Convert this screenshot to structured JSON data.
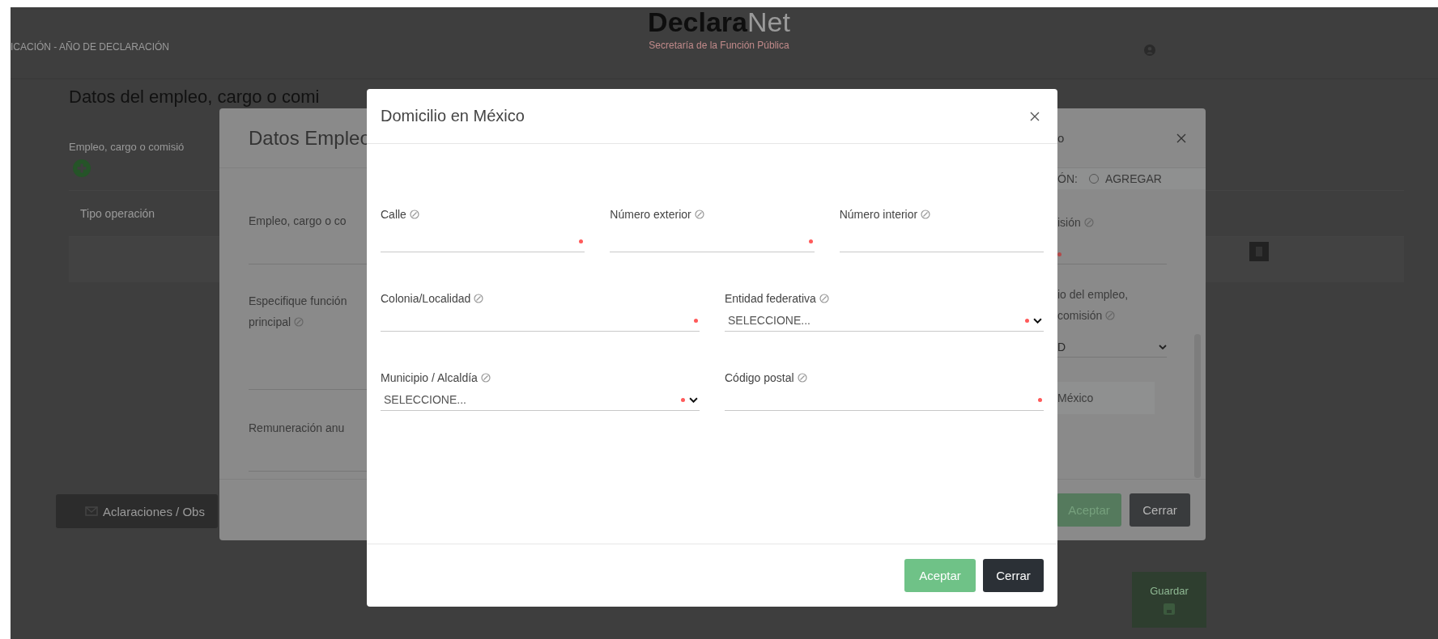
{
  "header": {
    "breadcrumb": "ICACIÓN - AÑO DE DECLARACIÓN",
    "logo": {
      "bold": "Declara",
      "light": "Net"
    },
    "subtitle": "Secretaría de la Función Pública"
  },
  "page": {
    "heading": "Datos del empleo, cargo o comi",
    "section_label": "Empleo, cargo o comisió",
    "table": {
      "columns": [
        "Tipo operación"
      ]
    },
    "notes_button": "Aclaraciones / Obs",
    "save_button": "Guardar"
  },
  "employment_dialog": {
    "title": "Datos Empleo",
    "title_end": "o",
    "operation": {
      "label": "ÓN:",
      "option": "AGREGAR",
      "selected": false
    },
    "left_fields": [
      {
        "label": "Empleo, cargo o co",
        "info": false
      },
      {
        "label": "Especifique función principal",
        "info": true
      },
      {
        "label": "Remuneración anu",
        "info": false
      }
    ],
    "right_fields": [
      {
        "kind": "text",
        "label_lines": [
          "isión"
        ],
        "required": true
      },
      {
        "kind": "select",
        "label_lines": [
          "io del empleo,",
          "comisión"
        ],
        "value": "D",
        "required": false
      },
      {
        "kind": "note",
        "text": "México"
      }
    ],
    "buttons": [
      {
        "label": "Aceptar",
        "kind": "primary"
      },
      {
        "label": "Cerrar",
        "kind": "secondary"
      }
    ]
  },
  "address_dialog": {
    "title": "Domicilio en México",
    "rows": [
      [
        {
          "kind": "text",
          "label": "Calle",
          "info": true,
          "required": true
        },
        {
          "kind": "text",
          "label": "Número exterior",
          "info": true,
          "required": true
        },
        {
          "kind": "text",
          "label": "Número interior",
          "info": true,
          "required": false
        }
      ],
      [
        {
          "kind": "text",
          "label": "Colonia/Localidad",
          "info": true,
          "required": true
        },
        {
          "kind": "select",
          "label": "Entidad federativa",
          "info": true,
          "required": true,
          "value": "SELECCIONE..."
        }
      ],
      [
        {
          "kind": "select",
          "label": "Municipio / Alcaldía",
          "info": true,
          "required": true,
          "value": "SELECCIONE..."
        },
        {
          "kind": "text",
          "label": "Código postal",
          "info": true,
          "required": true
        }
      ]
    ],
    "buttons": [
      {
        "label": "Aceptar",
        "kind": "primary"
      },
      {
        "label": "Cerrar",
        "kind": "secondary"
      }
    ]
  }
}
